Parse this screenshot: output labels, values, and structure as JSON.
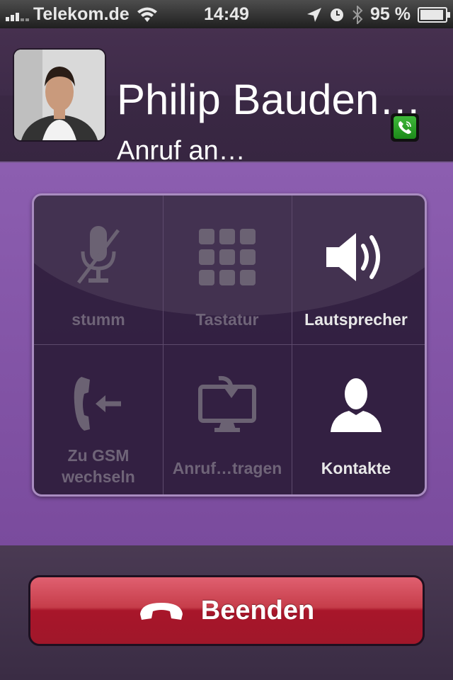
{
  "status_bar": {
    "carrier": "Telekom.de",
    "time": "14:49",
    "battery_percent_label": "95 %",
    "battery_level": 0.95,
    "icons": [
      "signal-bars-icon",
      "wifi-icon",
      "location-arrow-icon",
      "alarm-clock-icon",
      "bluetooth-icon",
      "battery-icon"
    ]
  },
  "caller": {
    "name": "Philip Bauden…",
    "status": "Anruf an…",
    "app_badge_icon": "viber-phone-icon"
  },
  "controls": [
    {
      "key": "mute",
      "label": "stumm",
      "icon": "muted-microphone-icon",
      "enabled": false
    },
    {
      "key": "keypad",
      "label": "Tastatur",
      "icon": "keypad-icon",
      "enabled": false
    },
    {
      "key": "speaker",
      "label": "Lautsprecher",
      "icon": "speaker-icon",
      "enabled": true
    },
    {
      "key": "gsm",
      "label": "Zu GSM\nwechseln",
      "icon": "switch-to-gsm-icon",
      "enabled": false
    },
    {
      "key": "transfer",
      "label": "Anruf…tragen",
      "icon": "transfer-call-icon",
      "enabled": false
    },
    {
      "key": "contacts",
      "label": "Kontakte",
      "icon": "contact-person-icon",
      "enabled": true
    }
  ],
  "end_call": {
    "label": "Beenden",
    "icon": "hang-up-phone-icon"
  },
  "colors": {
    "accent_purple": "#8c5eb0",
    "end_red": "#a8162a",
    "badge_green": "#2fa52b"
  }
}
